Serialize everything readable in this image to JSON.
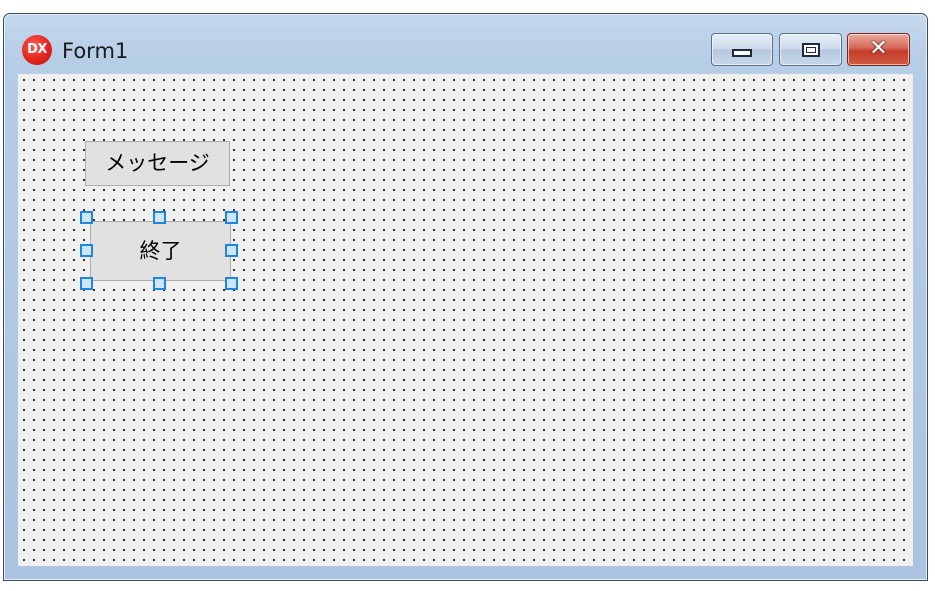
{
  "window": {
    "title": "Form1",
    "app_icon_text": "DX",
    "icon": "dx-app-icon",
    "accent_color": "#1d86e0",
    "close_color": "#c33d2a"
  },
  "titlebar": {
    "minimize_icon": "minimize-icon",
    "maximize_icon": "maximize-icon",
    "close_icon": "close-icon",
    "close_glyph": "✕"
  },
  "form": {
    "buttons": [
      {
        "label": "メッセージ",
        "selected": false
      },
      {
        "label": "終了",
        "selected": true
      }
    ]
  }
}
